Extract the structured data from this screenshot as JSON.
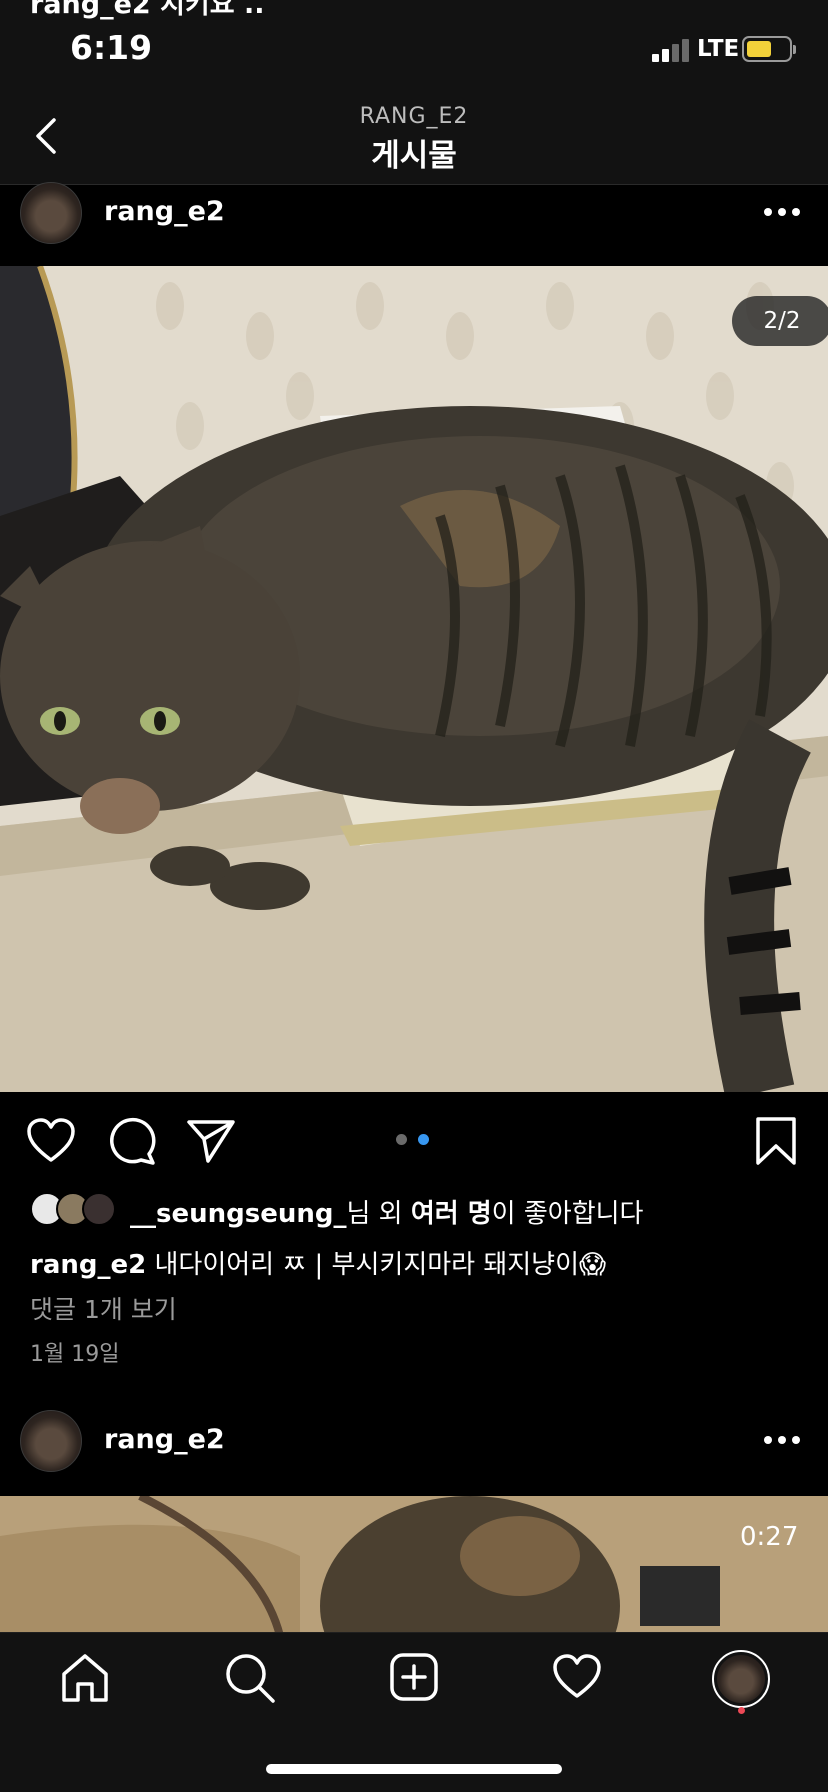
{
  "status_bar": {
    "bleed_text": "rang_e2 지키요 ..",
    "time": "6:19",
    "network": "LTE",
    "battery_color": "#f2d13a"
  },
  "nav": {
    "subtitle": "RANG_E2",
    "title": "게시물"
  },
  "post": {
    "username": "rang_e2",
    "image_counter": "2/2",
    "carousel": {
      "total": 2,
      "active": 2,
      "active_color": "#3897f0"
    },
    "likes": {
      "first_liker": "__seungseung_",
      "suffix_1": "님 외 ",
      "others": "여러 명",
      "suffix_2": "이 좋아합니다"
    },
    "caption": {
      "username": "rang_e2",
      "text": "내다이어리 ㅉ | 부시키지마라 돼지냥이😱"
    },
    "view_comments": "댓글 1개 보기",
    "date": "1월 19일"
  },
  "next_post": {
    "username": "rang_e2",
    "video_time": "0:27"
  },
  "tab_bar": {
    "items": [
      "home-icon",
      "search-icon",
      "new-post-icon",
      "activity-icon",
      "profile-avatar"
    ],
    "notification_color": "#ed4956"
  }
}
